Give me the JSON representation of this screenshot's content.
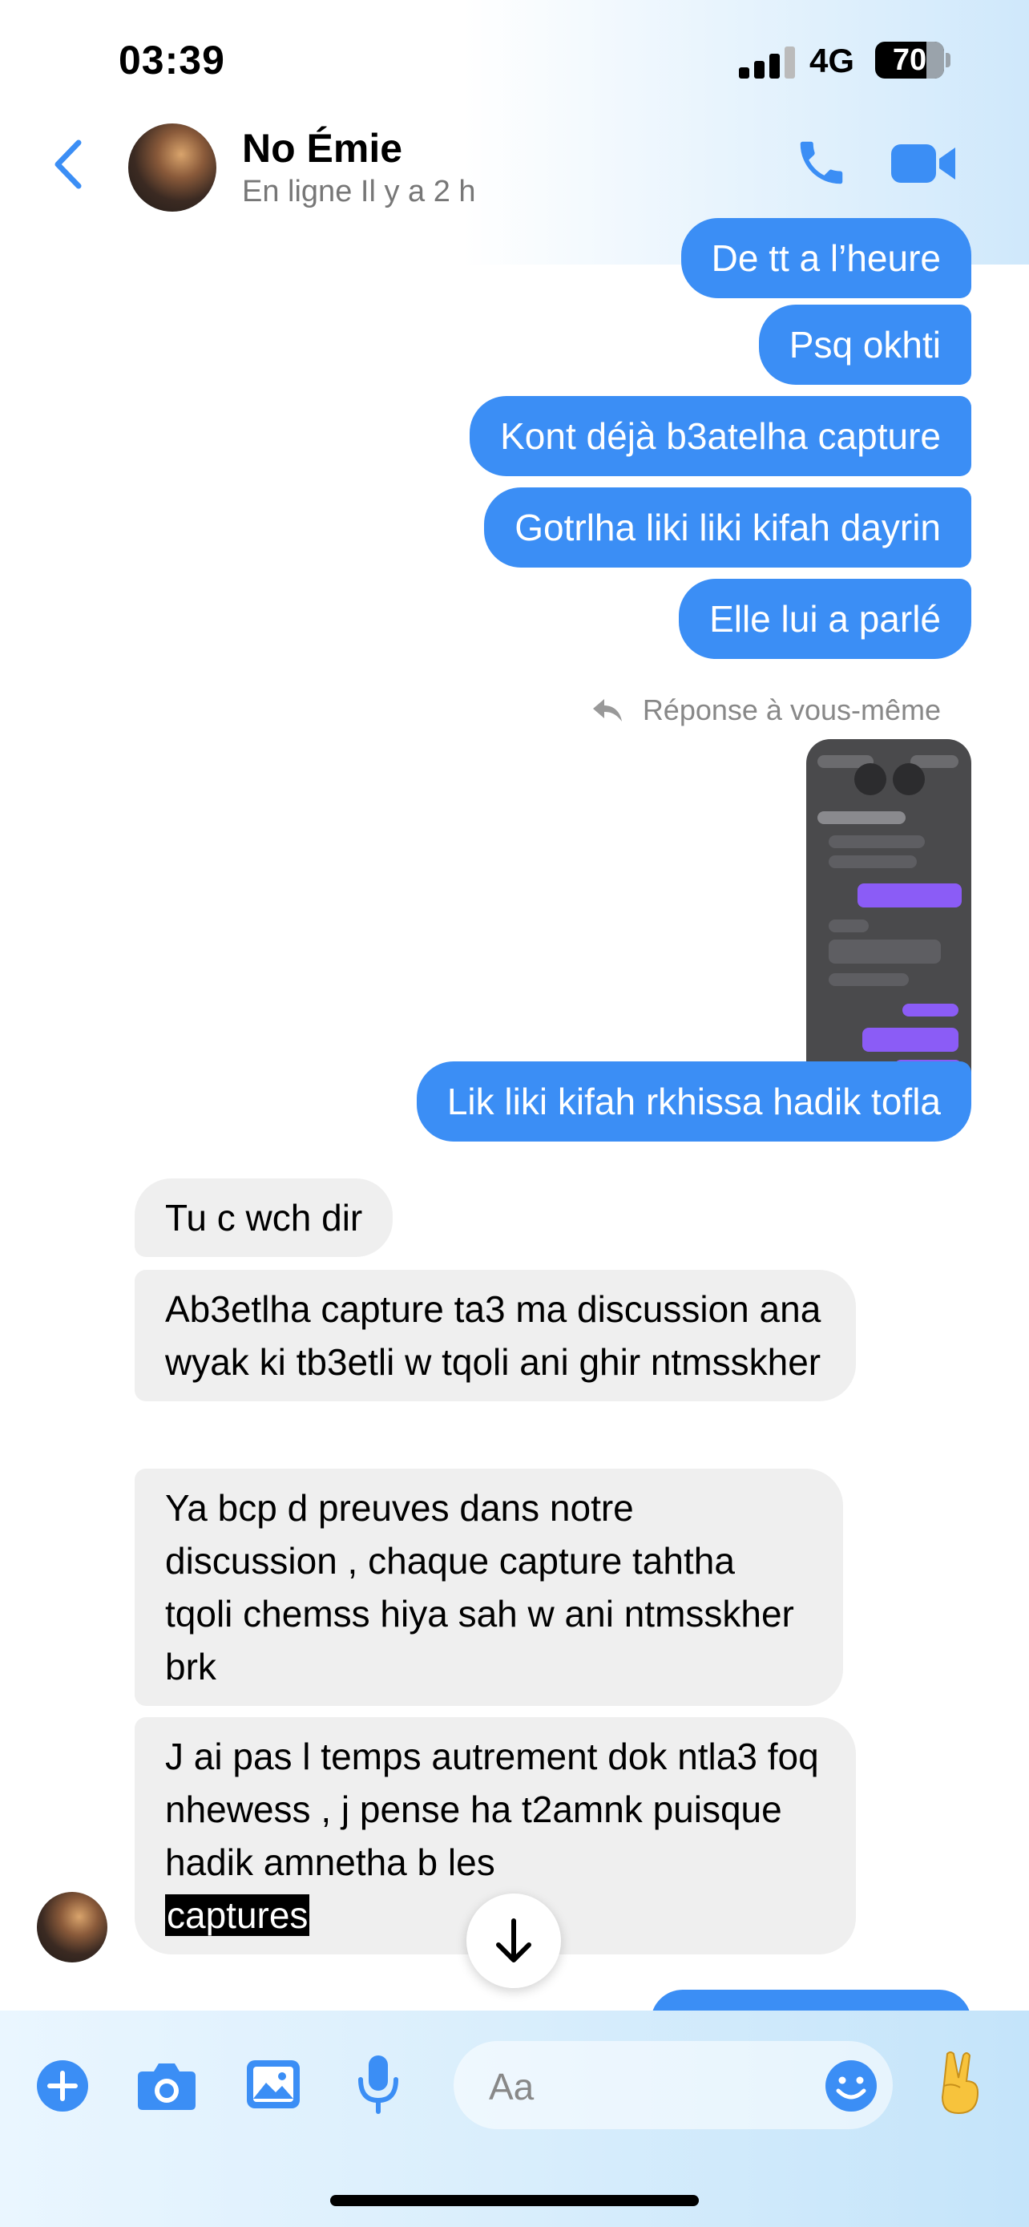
{
  "status_bar": {
    "time": "03:39",
    "network": "4G",
    "battery": "70"
  },
  "header": {
    "contact_name": "No Émie",
    "status": "En ligne Il y a 2 h"
  },
  "messages": {
    "out": [
      "De tt a l’heure",
      "Psq okhti",
      "Kont déjà b3atelha capture",
      "Gotrlha liki liki kifah dayrin",
      "Elle lui a parlé",
      "Lik liki kifah rkhissa hadik tofla"
    ],
    "reply_note": "Réponse à vous-même",
    "in": [
      "Tu c wch dir",
      "Ab3etlha capture ta3 ma discussion ana wyak  ki tb3etli w tqoli ani ghir ntmsskher",
      "Ya bcp d preuves dans notre discussion , chaque capture tahtha tqoli chemss hiya sah w ani ntmsskher brk",
      "J ai pas l temps autrement dok ntla3 foq nhewess , j pense ha t2amnk puisque hadik amnetha b les"
    ],
    "in_highlight": "captures"
  },
  "composer": {
    "placeholder": "Aa"
  },
  "icons": {
    "back": "chevron-left-icon",
    "phone": "phone-icon",
    "video": "video-camera-icon",
    "plus": "plus-icon",
    "camera": "camera-icon",
    "gallery": "image-icon",
    "mic": "microphone-icon",
    "emoji": "emoji-icon",
    "gesture": "peace-hand-icon",
    "scroll": "arrow-down-icon",
    "reply": "reply-icon"
  },
  "colors": {
    "accent": "#3b8ef5",
    "incoming_bubble": "#efefef"
  }
}
